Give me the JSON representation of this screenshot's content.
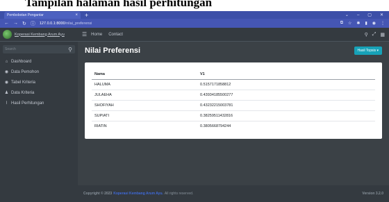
{
  "doc_title": "Tampilan halaman hasil perhitungan",
  "browser": {
    "tab_title": "Pembobotan Pengantar",
    "tab_close": "×",
    "new_tab": "+",
    "url_host": "127.0.0.1:8000",
    "url_path": "/nilai_preferensi"
  },
  "sidebar": {
    "brand": "Koperasi Kembang Arum Ayu",
    "search_placeholder": "Search",
    "items": [
      {
        "label": "Dashboard",
        "icon": "dashboard-icon"
      },
      {
        "label": "Data Pemohon",
        "icon": "user-icon"
      },
      {
        "label": "Tabel Kriteria",
        "icon": "user-icon"
      },
      {
        "label": "Data Kriteria",
        "icon": "users-icon"
      },
      {
        "label": "Hasil Perhitungan",
        "icon": "chart-icon"
      }
    ]
  },
  "topnav": {
    "home": "Home",
    "contact": "Contact"
  },
  "page": {
    "title": "Nilai Preferensi",
    "dropdown_label": "Hasil Topsis"
  },
  "table": {
    "headers": [
      "Nama",
      "V1"
    ],
    "rows": [
      [
        "HALUMA",
        "0.5157171858812"
      ],
      [
        "JULAEHA",
        "0.43934185500277"
      ],
      [
        "SHOFIYAH",
        "0.43232215003781"
      ],
      [
        "SUPIATI",
        "0.38259511432816"
      ],
      [
        "RIATIN",
        "0.3805668794244"
      ]
    ]
  },
  "footer": {
    "prefix": "Copyright © 2023",
    "link": "Koperasi Kembang Arum Ayu.",
    "suffix": "All rights reserved.",
    "version": "Version 3.2.0"
  },
  "colors": {
    "sidebar_bg": "#343a40",
    "content_bg": "#3b4146",
    "accent": "#17a2b8",
    "browser_bar": "#4556b4"
  }
}
